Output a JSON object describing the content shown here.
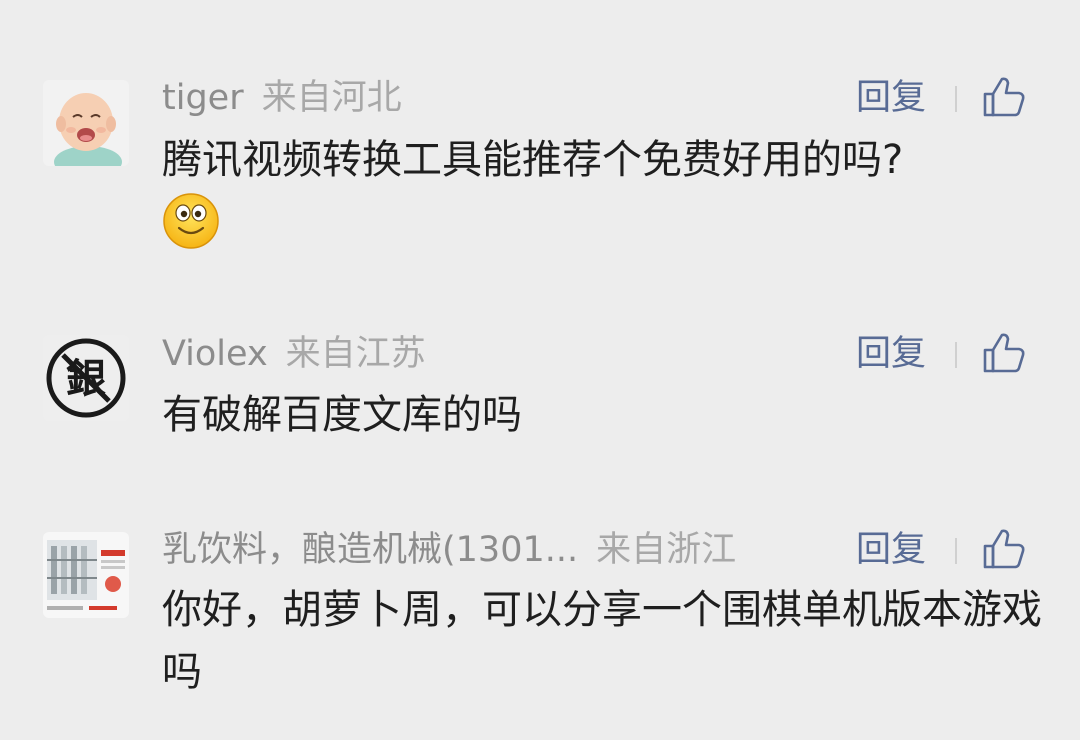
{
  "comments": [
    {
      "name": "tiger",
      "location": "来自河北",
      "reply_label": "回复",
      "text": "腾讯视频转换工具能推荐个免费好用的吗?",
      "emoji": "smile-emoji"
    },
    {
      "name": "Violex",
      "location": "来自江苏",
      "reply_label": "回复",
      "text": "有破解百度文库的吗",
      "avatar_char": "銀"
    },
    {
      "name": "乳饮料，酿造机械(1301...",
      "location": "来自浙江",
      "reply_label": "回复",
      "text": "你好，胡萝卜周，可以分享一个围棋单机版本游戏吗"
    }
  ],
  "icons": {
    "like": "thumbs-up-icon"
  },
  "colors": {
    "background": "#ededed",
    "reply_link": "#586b95",
    "meta_text": "#8c8c8c"
  }
}
